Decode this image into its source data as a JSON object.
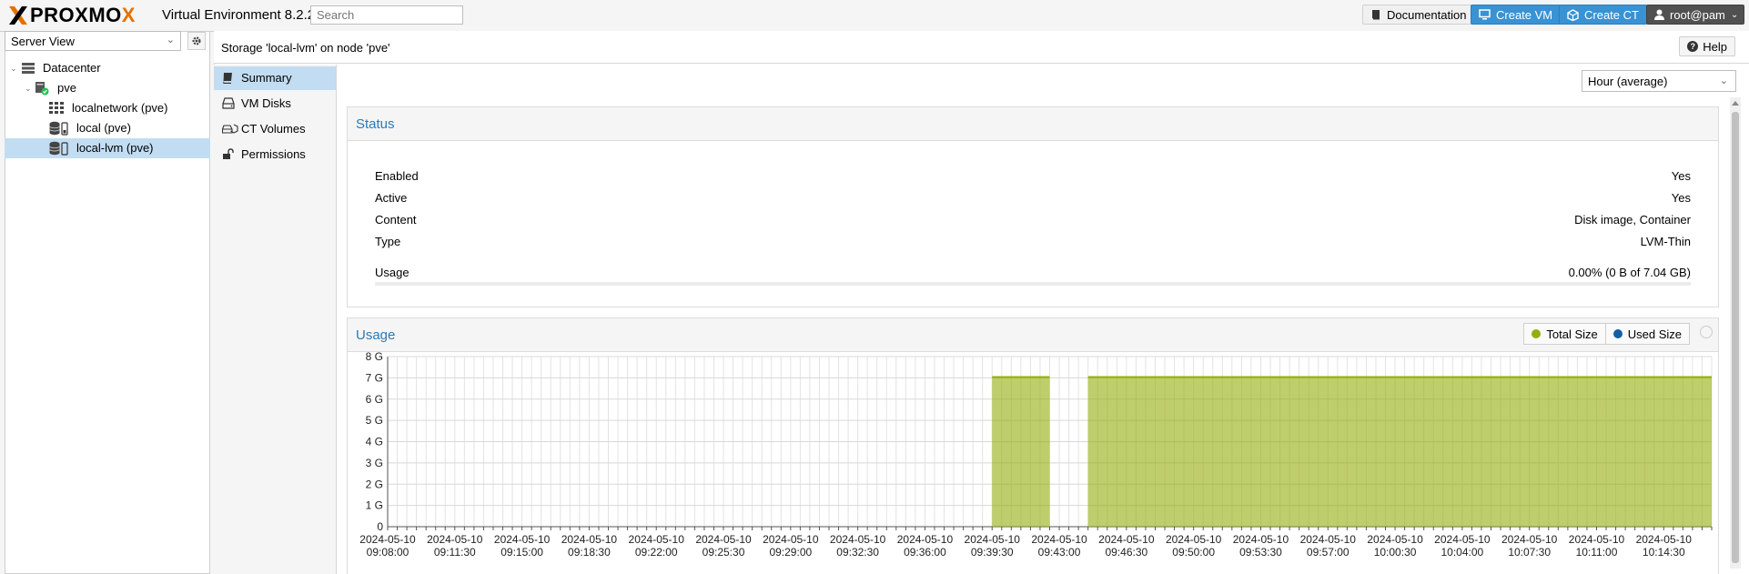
{
  "app": {
    "logo_text": "PROXMOX",
    "version": "Virtual Environment 8.2.2",
    "search_placeholder": "Search",
    "buttons": {
      "documentation": "Documentation",
      "create_vm": "Create VM",
      "create_ct": "Create CT",
      "user": "root@pam"
    }
  },
  "sidebar": {
    "view_selector": "Server View",
    "tree": [
      {
        "label": "Datacenter",
        "icon": "datacenter-icon"
      },
      {
        "label": "pve",
        "icon": "node-online-icon"
      },
      {
        "label": "localnetwork (pve)",
        "icon": "network-grid-icon"
      },
      {
        "label": "local (pve)",
        "icon": "storage-icon"
      },
      {
        "label": "local-lvm (pve)",
        "icon": "storage-icon",
        "selected": true
      }
    ]
  },
  "header": {
    "title": "Storage 'local-lvm' on node 'pve'",
    "help": "Help"
  },
  "subnav": {
    "items": [
      {
        "label": "Summary",
        "icon": "book-icon",
        "selected": true
      },
      {
        "label": "VM Disks",
        "icon": "hdd-icon"
      },
      {
        "label": "CT Volumes",
        "icon": "container-disk-icon"
      },
      {
        "label": "Permissions",
        "icon": "unlock-icon"
      }
    ]
  },
  "timeframe": "Hour (average)",
  "status": {
    "title": "Status",
    "rows": [
      {
        "key": "Enabled",
        "value": "Yes"
      },
      {
        "key": "Active",
        "value": "Yes"
      },
      {
        "key": "Content",
        "value": "Disk image, Container"
      },
      {
        "key": "Type",
        "value": "LVM-Thin"
      },
      {
        "key": "Usage",
        "value": "0.00% (0 B of 7.04 GB)"
      }
    ],
    "usage_fraction": 0.0
  },
  "usage_panel": {
    "title": "Usage",
    "legend": [
      "Total Size",
      "Used Size"
    ]
  },
  "colors": {
    "accent": "#2d79b5",
    "total_size": "#94ae0a",
    "used_size": "#115fa6",
    "selected_bg": "#c2ddf2",
    "brand_orange": "#e57000"
  },
  "chart_data": {
    "type": "area",
    "title": "Usage",
    "xlabel": "",
    "ylabel": "",
    "ylim": [
      0,
      8
    ],
    "y_ticks": [
      "0",
      "1 G",
      "2 G",
      "3 G",
      "4 G",
      "5 G",
      "6 G",
      "7 G",
      "8 G"
    ],
    "x_ticks": [
      {
        "date": "2024-05-10",
        "time": "09:08:00"
      },
      {
        "date": "2024-05-10",
        "time": "09:11:30"
      },
      {
        "date": "2024-05-10",
        "time": "09:15:00"
      },
      {
        "date": "2024-05-10",
        "time": "09:18:30"
      },
      {
        "date": "2024-05-10",
        "time": "09:22:00"
      },
      {
        "date": "2024-05-10",
        "time": "09:25:30"
      },
      {
        "date": "2024-05-10",
        "time": "09:29:00"
      },
      {
        "date": "2024-05-10",
        "time": "09:32:30"
      },
      {
        "date": "2024-05-10",
        "time": "09:36:00"
      },
      {
        "date": "2024-05-10",
        "time": "09:39:30"
      },
      {
        "date": "2024-05-10",
        "time": "09:43:00"
      },
      {
        "date": "2024-05-10",
        "time": "09:46:30"
      },
      {
        "date": "2024-05-10",
        "time": "09:50:00"
      },
      {
        "date": "2024-05-10",
        "time": "09:53:30"
      },
      {
        "date": "2024-05-10",
        "time": "09:57:00"
      },
      {
        "date": "2024-05-10",
        "time": "10:00:30"
      },
      {
        "date": "2024-05-10",
        "time": "10:04:00"
      },
      {
        "date": "2024-05-10",
        "time": "10:07:30"
      },
      {
        "date": "2024-05-10",
        "time": "10:11:00"
      },
      {
        "date": "2024-05-10",
        "time": "10:14:30"
      }
    ],
    "grid": true,
    "legend_position": "top-right",
    "x_range": [
      "09:08:00",
      "10:17:00"
    ],
    "series": [
      {
        "name": "Total Size",
        "color": "#94ae0a",
        "segments": [
          {
            "start": "09:39:30",
            "end": "09:42:30",
            "value": 7.04
          },
          {
            "start": "09:44:30",
            "end": "10:17:00",
            "value": 7.04
          }
        ]
      },
      {
        "name": "Used Size",
        "color": "#115fa6",
        "segments": [
          {
            "start": "09:39:30",
            "end": "09:42:30",
            "value": 0
          },
          {
            "start": "09:44:30",
            "end": "10:17:00",
            "value": 0
          }
        ]
      }
    ]
  }
}
